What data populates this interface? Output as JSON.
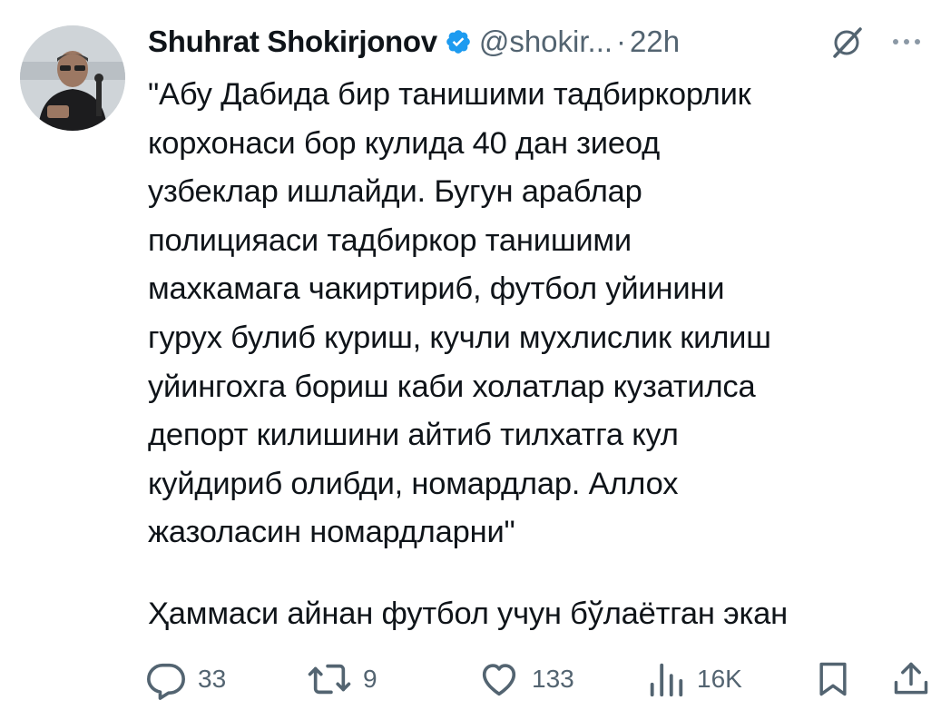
{
  "tweet": {
    "author_name": "Shuhrat Shokirjonov",
    "handle": "@shokir...",
    "separator": "·",
    "time": "22h",
    "body_lines": [
      "\"Абу Дабида бир танишими тадбиркорлик",
      "корхонаси бор кулида 40 дан зиеод",
      "узбеклар ишлайди. Бугун араблар",
      "полицияаси тадбиркор танишими",
      "махкамага чакиртириб, футбол уйинини",
      "гурух булиб куриш, кучли мухлислик килиш",
      "уйингохга бориш каби холатлар кузатилса",
      "депорт килишини айтиб тилхатга кул",
      "куйдириб олибди, номардлар. Аллох",
      "жазоласин номардларни\""
    ],
    "second_paragraph": "Ҳаммаси айнан футбол учун бўлаётган экан"
  },
  "actions": {
    "replies": "33",
    "reposts": "9",
    "likes": "133",
    "views": "16K"
  },
  "icons": {
    "verified": "verified-badge-icon",
    "grok": "grok-icon",
    "more": "more-icon",
    "reply": "reply-icon",
    "repost": "repost-icon",
    "like": "heart-icon",
    "views": "views-icon",
    "bookmark": "bookmark-icon",
    "share": "share-icon"
  },
  "colors": {
    "text": "#0f1419",
    "secondary": "#536471",
    "verified": "#1d9bf0"
  }
}
